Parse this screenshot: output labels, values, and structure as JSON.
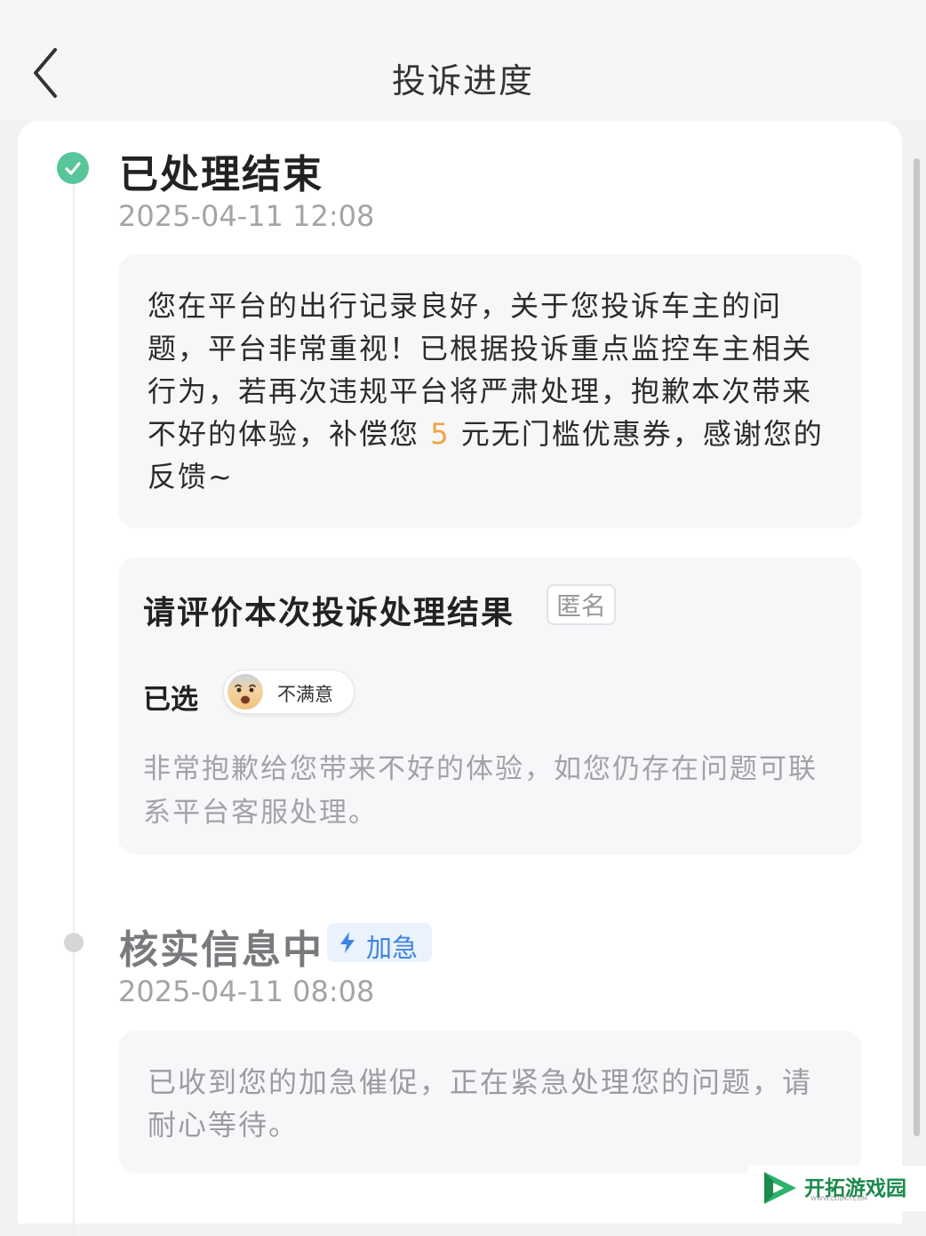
{
  "header": {
    "back_icon": "chevron-left-icon",
    "title": "投诉进度"
  },
  "timeline": [
    {
      "status": "已处理结束",
      "state": "done",
      "dot_color": "#58c59a",
      "time": "2025-04-11 12:08",
      "message_parts": {
        "before": "您在平台的出行记录良好，关于您投诉车主的问题，平台非常重视！已根据投诉重点监控车主相关行为，若再次违规平台将严肃处理，抱歉本次带来不好的体验，补偿您 ",
        "amount": "5",
        "after": " 元无门槛优惠券，感谢您的反馈~"
      },
      "evaluation": {
        "title": "请评价本次投诉处理结果",
        "anonymous_tag": "匿名",
        "selected_label": "已选",
        "selected_rating": "不满意",
        "rating_icon": "dissatisfied-face-icon",
        "description": "非常抱歉给您带来不好的体验，如您仍存在问题可联系平台客服处理。"
      }
    },
    {
      "status": "核实信息中",
      "state": "pending",
      "dot_color": "#d6d6d8",
      "urgent_tag": "加急",
      "urgent_icon": "lightning-bolt-icon",
      "time": "2025-04-11 08:08",
      "message": "已收到您的加急催促，正在紧急处理您的问题，请耐心等待。"
    }
  ],
  "colors": {
    "success": "#58c59a",
    "highlight": "#f0a243",
    "urgent": "#3e83e3"
  },
  "watermark": {
    "name": "开拓游戏园",
    "url": "WWW.CDDKT.COM"
  }
}
